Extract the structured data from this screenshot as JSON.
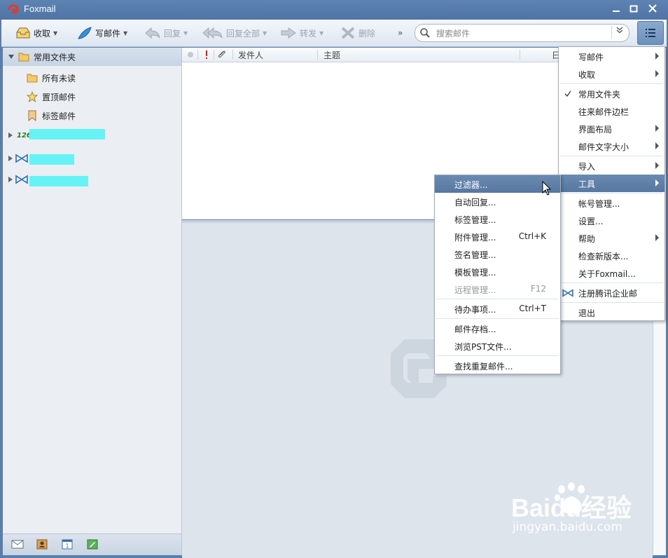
{
  "window": {
    "title": "Foxmail"
  },
  "toolbar": {
    "receive": "收取",
    "compose": "写邮件",
    "reply": "回复",
    "reply_all": "回复全部",
    "forward": "转发",
    "delete": "删除",
    "more": "»",
    "search_placeholder": "搜索邮件"
  },
  "sidebar": {
    "header": "常用文件夹",
    "items": [
      {
        "label": "所有未读"
      },
      {
        "label": "置顶邮件"
      },
      {
        "label": "标签邮件"
      }
    ],
    "accounts": [
      {
        "badge": "126"
      },
      {
        "badge": ""
      },
      {
        "badge": ""
      }
    ]
  },
  "list": {
    "columns": [
      "发件人",
      "主题",
      "日"
    ]
  },
  "main_menu": {
    "items": [
      {
        "label": "写邮件"
      },
      {
        "label": "收取"
      },
      {
        "label": "常用文件夹"
      },
      {
        "label": "往来邮件边栏"
      },
      {
        "label": "界面布局"
      },
      {
        "label": "邮件文字大小"
      },
      {
        "label": "导入"
      },
      {
        "label": "工具"
      },
      {
        "label": "帐号管理..."
      },
      {
        "label": "设置..."
      },
      {
        "label": "帮助"
      },
      {
        "label": "检查新版本..."
      },
      {
        "label": "关于Foxmail..."
      },
      {
        "label": "注册腾讯企业邮"
      },
      {
        "label": "退出"
      }
    ]
  },
  "tools_menu": {
    "items": [
      {
        "label": "过滤器...",
        "shortcut": ""
      },
      {
        "label": "自动回复...",
        "shortcut": ""
      },
      {
        "label": "标签管理...",
        "shortcut": ""
      },
      {
        "label": "附件管理...",
        "shortcut": "Ctrl+K"
      },
      {
        "label": "签名管理...",
        "shortcut": ""
      },
      {
        "label": "模板管理...",
        "shortcut": ""
      },
      {
        "label": "远程管理...",
        "shortcut": "F12"
      },
      {
        "label": "待办事项...",
        "shortcut": "Ctrl+T"
      },
      {
        "label": "邮件存档...",
        "shortcut": ""
      },
      {
        "label": "浏览PST文件...",
        "shortcut": ""
      },
      {
        "label": "查找重复邮件...",
        "shortcut": ""
      }
    ]
  },
  "watermark": {
    "brand": "Baidu经验",
    "url": "jingyan.baidu.com"
  },
  "colors": {
    "accent": "#56779f",
    "brand_red": "#e13a2a",
    "redaction": "#66f3f5"
  }
}
